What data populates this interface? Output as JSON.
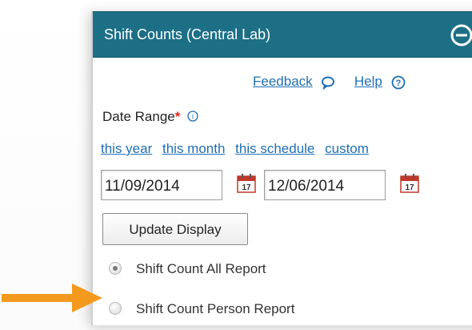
{
  "panel": {
    "title": "Shift Counts (Central Lab)",
    "header_color": "#1d6f86"
  },
  "links": {
    "feedback": "Feedback",
    "help": "Help"
  },
  "date_range": {
    "label": "Date Range",
    "required_marker": "*",
    "quick_links": [
      "this year",
      "this month",
      "this schedule",
      "custom"
    ],
    "start_date": "11/09/2014",
    "end_date": "12/06/2014",
    "calendar_day": "17"
  },
  "actions": {
    "update_label": "Update Display"
  },
  "report_options": [
    {
      "label": "Shift Count All Report",
      "checked": true
    },
    {
      "label": "Shift Count Person Report",
      "checked": false
    }
  ],
  "icons": {
    "collapse": "minus-circle-icon",
    "feedback": "speech-bubble-icon",
    "help": "question-circle-icon",
    "info": "info-circle-icon",
    "calendar": "calendar-icon",
    "pointer": "arrow-right-icon"
  },
  "colors": {
    "link": "#1f6fb5",
    "required": "#e0221a",
    "arrow": "#f39a1e"
  }
}
